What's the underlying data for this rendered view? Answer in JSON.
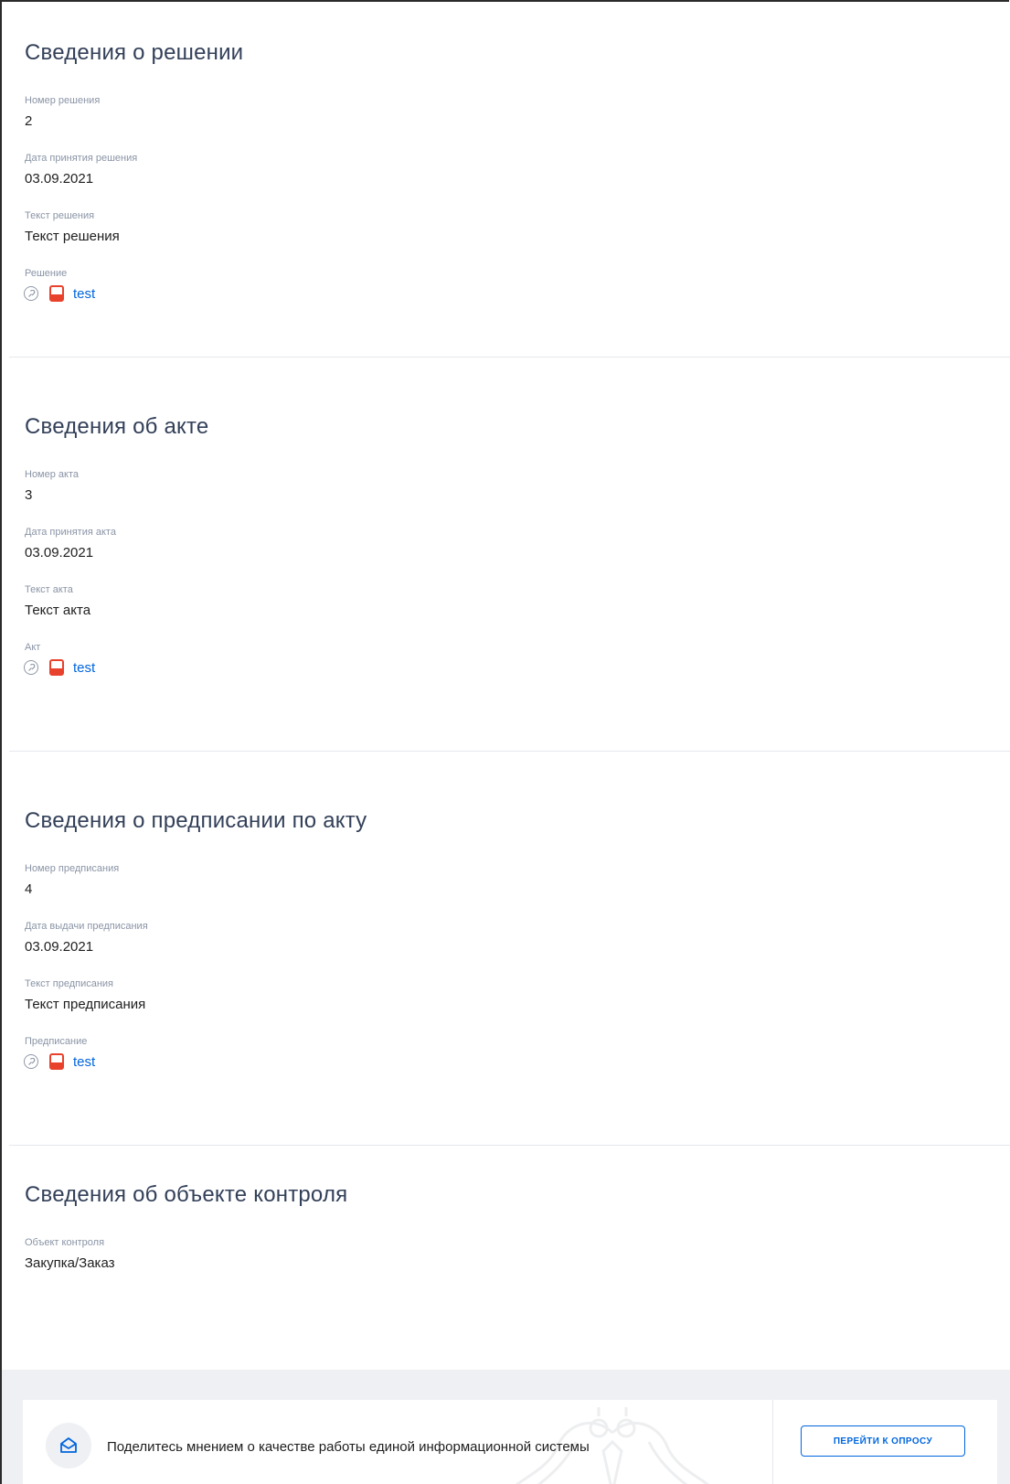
{
  "sections": [
    {
      "title": "Сведения о решении",
      "fields": [
        {
          "label": "Номер решения",
          "value": "2"
        },
        {
          "label": "Дата принятия решения",
          "value": "03.09.2021"
        },
        {
          "label": "Текст решения",
          "value": "Текст решения"
        }
      ],
      "file": {
        "label": "Решение",
        "name": "test"
      }
    },
    {
      "title": "Сведения об акте",
      "fields": [
        {
          "label": "Номер акта",
          "value": "3"
        },
        {
          "label": "Дата принятия акта",
          "value": "03.09.2021"
        },
        {
          "label": "Текст акта",
          "value": "Текст акта"
        }
      ],
      "file": {
        "label": "Акт",
        "name": "test"
      }
    },
    {
      "title": "Сведения о предписании по акту",
      "fields": [
        {
          "label": "Номер предписания",
          "value": "4"
        },
        {
          "label": "Дата выдачи предписания",
          "value": "03.09.2021"
        },
        {
          "label": "Текст предписания",
          "value": "Текст предписания"
        }
      ],
      "file": {
        "label": "Предписание",
        "name": "test"
      }
    },
    {
      "title": "Сведения об объекте контроля",
      "fields": [
        {
          "label": "Объект контроля",
          "value": "Закупка/Заказ"
        }
      ]
    }
  ],
  "survey": {
    "text": "Поделитесь мнением о качестве работы единой информационной системы",
    "button_label": "ПЕРЕЙТИ К ОПРОСУ",
    "icon": "envelope-icon"
  },
  "icons": {
    "signature": "signature-icon",
    "file": "pdf-file-icon"
  },
  "colors": {
    "link": "#0065dd",
    "heading": "#334059",
    "label": "#8a94a6",
    "pdf": "#e8412c"
  }
}
